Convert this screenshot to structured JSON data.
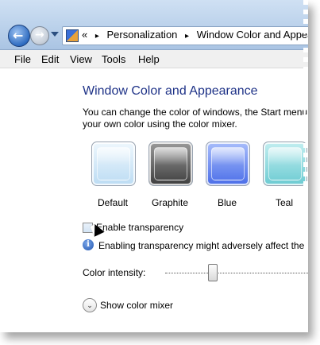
{
  "navigation": {
    "back_icon": "arrow-left-icon",
    "forward_icon": "arrow-right-icon",
    "history_icon": "chevron-down-icon"
  },
  "address_bar": {
    "prefix": "«",
    "crumbs": [
      "Personalization",
      "Window Color and Appearance"
    ],
    "separator": "▸"
  },
  "menu": {
    "items": [
      "File",
      "Edit",
      "View",
      "Tools",
      "Help"
    ]
  },
  "page": {
    "title": "Window Color and Appearance",
    "description_line1": "You can change the color of windows, the Start menu",
    "description_line2": "your own color using the color mixer."
  },
  "swatches": [
    {
      "label": "Default",
      "color": "#cfe6f7"
    },
    {
      "label": "Graphite",
      "color": "#6b6b6b"
    },
    {
      "label": "Blue",
      "color": "#6e8ef0"
    },
    {
      "label": "Teal",
      "color": "#8fd8dc"
    }
  ],
  "transparency": {
    "label": "Enable transparency",
    "checked": false
  },
  "info": {
    "icon": "i",
    "text": "Enabling transparency might adversely affect the"
  },
  "intensity": {
    "label": "Color intensity:",
    "value_percent": 30
  },
  "mixer": {
    "icon": "⌄",
    "label": "Show color mixer"
  }
}
